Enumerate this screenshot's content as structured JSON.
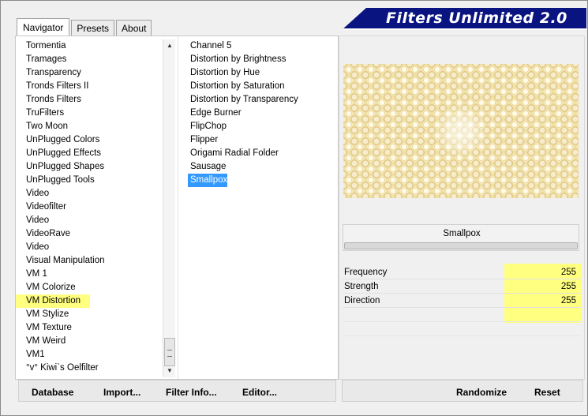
{
  "banner": {
    "title": "Filters Unlimited 2.0"
  },
  "tabs": [
    {
      "label": "Navigator"
    },
    {
      "label": "Presets"
    },
    {
      "label": "About"
    }
  ],
  "categories": [
    "Tormentia",
    "Tramages",
    "Transparency",
    "Tronds Filters II",
    "Tronds Filters",
    "TruFilters",
    "Two Moon",
    "UnPlugged Colors",
    "UnPlugged Effects",
    "UnPlugged Shapes",
    "UnPlugged Tools",
    "Video",
    "Videofilter",
    "Video",
    "VideoRave",
    "Video",
    "Visual Manipulation",
    "VM 1",
    "VM Colorize",
    "VM Distortion",
    "VM Stylize",
    "VM Texture",
    "VM Weird",
    "VM1",
    "°v° Kiwi`s Oelfilter"
  ],
  "highlighted_category": "VM Distortion",
  "filters": [
    "Channel 5",
    "Distortion by Brightness",
    "Distortion by Hue",
    "Distortion by Saturation",
    "Distortion by Transparency",
    "Edge Burner",
    "FlipChop",
    "Flipper",
    "Origami Radial Folder",
    "Sausage",
    "Smallpox"
  ],
  "selected_filter": "Smallpox",
  "filter_panel": {
    "name": "Smallpox"
  },
  "params": [
    {
      "label": "Frequency",
      "value": "255"
    },
    {
      "label": "Strength",
      "value": "255"
    },
    {
      "label": "Direction",
      "value": "255"
    }
  ],
  "buttons_left": {
    "database": "Database",
    "import": "Import...",
    "filter_info": "Filter Info...",
    "editor": "Editor..."
  },
  "buttons_right": {
    "randomize": "Randomize",
    "reset": "Reset"
  },
  "colors": {
    "banner": "#0a1480",
    "highlight": "#ffff80",
    "selection": "#3399ff"
  }
}
